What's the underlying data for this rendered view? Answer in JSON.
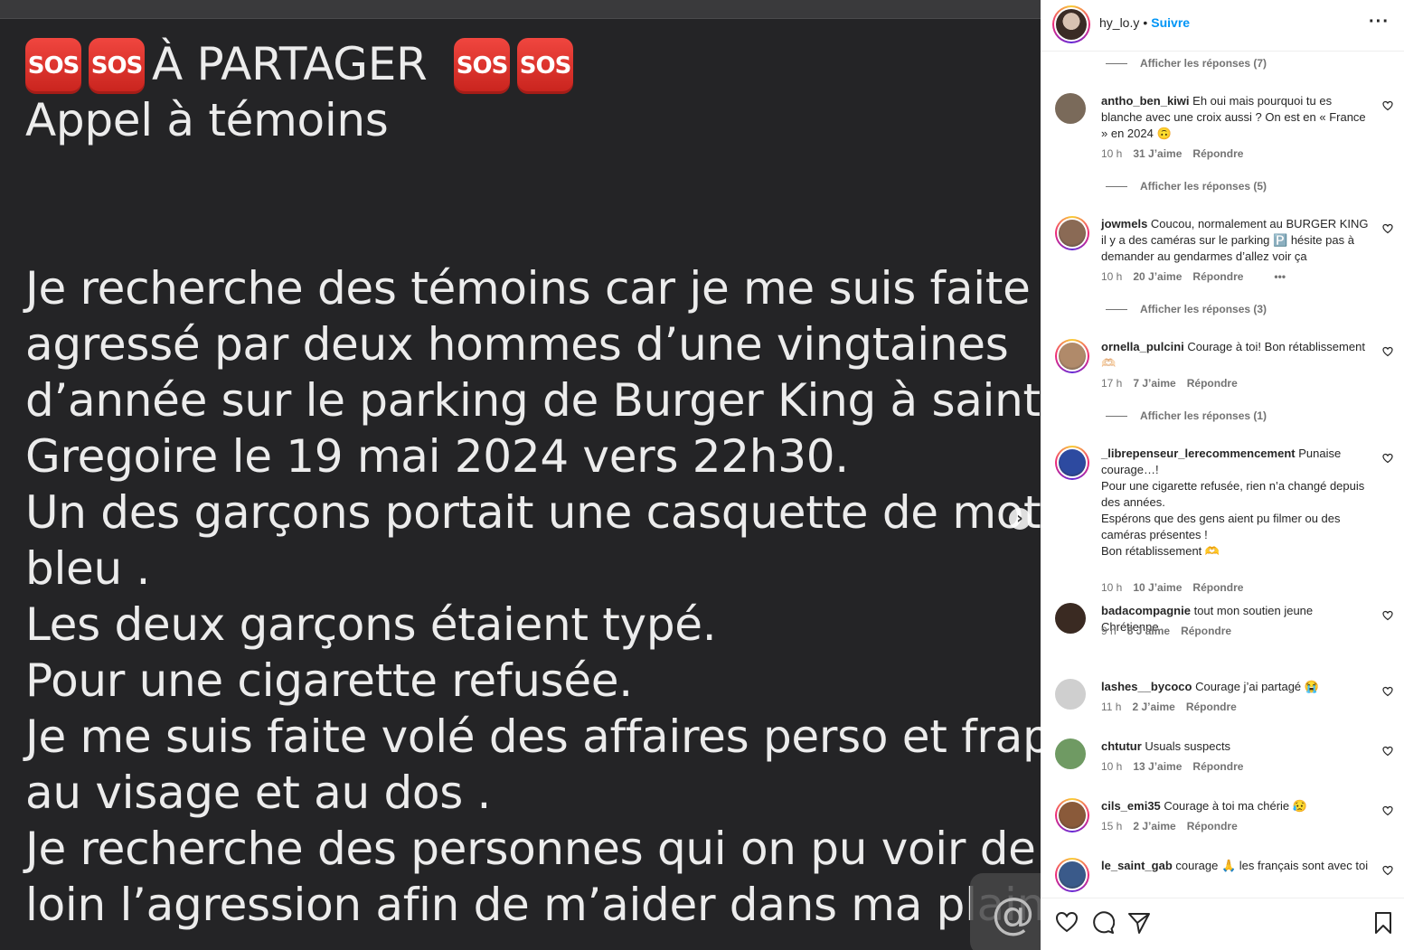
{
  "post": {
    "line1_text": "À PARTAGER",
    "sos_label": "SOS",
    "lines": [
      "Appel à témoins",
      "",
      "",
      "Je recherche des témoins car je me suis faite",
      "agressé par deux hommes d’une vingtaines",
      "d’année sur le parking de Burger King à saint",
      "Gregoire le 19 mai 2024 vers 22h30.",
      "Un des garçons portait une casquette de moto",
      "bleu .",
      "Les deux garçons étaient typé.",
      "Pour une cigarette refusée.",
      "Je me suis faite volé des affaires perso et frappé",
      "au visage et au dos .",
      "Je recherche des personnes qui on pu voir de",
      "loin l’agression afin de m’aider dans ma plaint"
    ],
    "next_icon": "chevron-right-icon",
    "at_symbol": "@"
  },
  "header": {
    "username": "hy_lo.y",
    "dot": "•",
    "follow_label": "Suivre",
    "more_icon": "more-horizontal-icon"
  },
  "comments": [
    {
      "kind": "replies",
      "label": "Afficher les réponses (7)"
    },
    {
      "kind": "comment",
      "user": "antho_ben_kiwi",
      "text": "Eh oui mais pourquoi tu es blanche avec une croix aussi ? On est en « France » en 2024 🙃",
      "time": "10 h",
      "likes": "31 J’aime",
      "reply": "Répondre",
      "extra": "",
      "avatar_color": "#7a6a5a"
    },
    {
      "kind": "replies",
      "label": "Afficher les réponses (5)"
    },
    {
      "kind": "comment",
      "user": "jowmels",
      "text": "Coucou, normalement au BURGER KING il y a des caméras sur le parking 🅿️ hésite pas à demander au gendarmes d’allez voir ça",
      "time": "10 h",
      "likes": "20 J’aime",
      "reply": "Répondre",
      "extra": "•••",
      "avatar_color": "#8a6a55",
      "ring": true
    },
    {
      "kind": "replies",
      "label": "Afficher les réponses (3)"
    },
    {
      "kind": "comment",
      "user": "ornella_pulcini",
      "text": "Courage à toi! Bon rétablissement🫶🏻",
      "time": "17 h",
      "likes": "7 J’aime",
      "reply": "Répondre",
      "extra": "",
      "avatar_color": "#b08a6a",
      "ring": true
    },
    {
      "kind": "replies",
      "label": "Afficher les réponses (1)"
    },
    {
      "kind": "comment",
      "user": "_librepenseur_lerecommencement",
      "text": "Punaise courage…!\nPour une cigarette refusée, rien n’a changé depuis des années.\nEspérons que des gens aient pu filmer ou des caméras présentes !\nBon rétablissement 🫶",
      "time": "10 h",
      "likes": "10 J’aime",
      "reply": "Répondre",
      "extra": "",
      "avatar_color": "#2d4aa0",
      "ring": true
    },
    {
      "kind": "comment",
      "user": "badacompagnie",
      "text": "tout mon soutien jeune Chrétienne",
      "time": "9 h",
      "likes": "8 J’aime",
      "reply": "Répondre",
      "extra": "",
      "avatar_color": "#3a2a22"
    },
    {
      "kind": "comment",
      "user": "lashes__bycoco",
      "text": "Courage j’ai partagé 😭",
      "time": "11 h",
      "likes": "2 J’aime",
      "reply": "Répondre",
      "extra": "",
      "avatar_color": "#cfcfcf"
    },
    {
      "kind": "comment",
      "user": "chtutur",
      "text": "Usuals suspects",
      "time": "10 h",
      "likes": "13 J’aime",
      "reply": "Répondre",
      "extra": "",
      "avatar_color": "#6f9a63"
    },
    {
      "kind": "comment",
      "user": "cils_emi35",
      "text": "Courage à toi ma chérie 😥",
      "time": "15 h",
      "likes": "2 J’aime",
      "reply": "Répondre",
      "extra": "",
      "avatar_color": "#8a5a3a",
      "ring": true
    },
    {
      "kind": "comment",
      "user": "le_saint_gab",
      "text": "courage 🙏 les français sont avec toi",
      "time": "",
      "likes": "",
      "reply": "",
      "extra": "",
      "avatar_color": "#3a5a8a",
      "ring": true
    }
  ],
  "actions": {
    "like_icon": "heart-icon",
    "comment_icon": "comment-icon",
    "share_icon": "send-icon",
    "save_icon": "bookmark-icon"
  },
  "colors": {
    "accent": "#0095f6",
    "meta": "#737373",
    "sos": "#e03a33"
  }
}
